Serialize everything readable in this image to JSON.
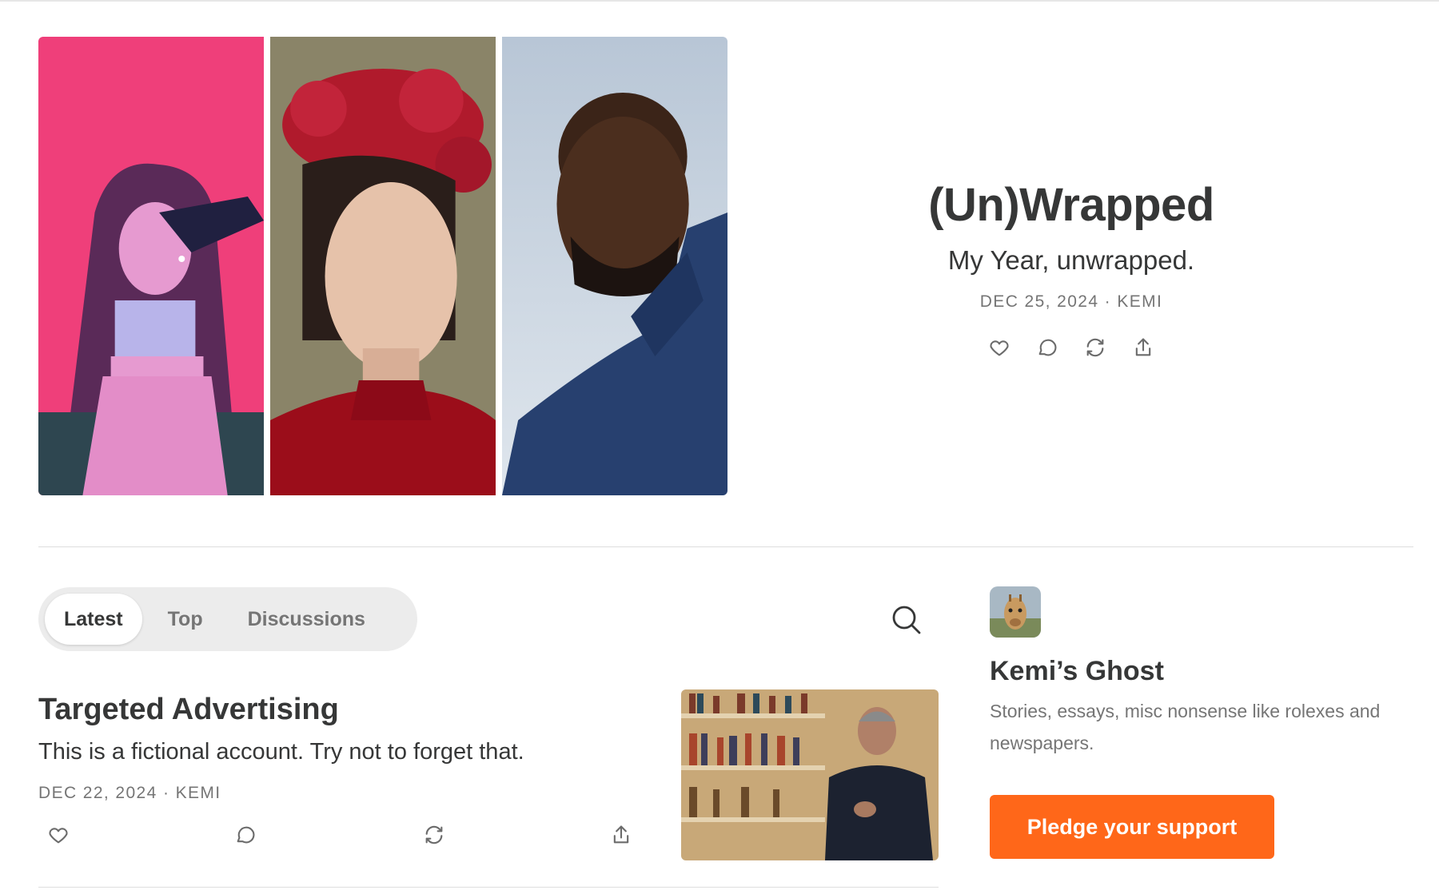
{
  "hero": {
    "title": "(Un)Wrapped",
    "subtitle": "My Year, unwrapped.",
    "meta": "DEC 25, 2024 · KEMI",
    "images": [
      "illustrated-woman-with-crow",
      "woman-with-red-flower-crown",
      "man-in-blue-shirt"
    ]
  },
  "tabs": [
    {
      "label": "Latest",
      "active": true
    },
    {
      "label": "Top",
      "active": false
    },
    {
      "label": "Discussions",
      "active": false
    }
  ],
  "post": {
    "title": "Targeted Advertising",
    "subtitle": "This is a fictional account. Try not to forget that.",
    "meta": "DEC 22, 2024 · KEMI",
    "thumbnail": "man-with-bookshelf"
  },
  "sidebar": {
    "publication_name": "Kemi’s Ghost",
    "description": "Stories, essays, misc nonsense like rolexes and newspapers.",
    "pledge_label": "Pledge your support",
    "avatar": "giraffe-avatar"
  },
  "icons": {
    "like": "heart-icon",
    "comment": "comment-icon",
    "restack": "restack-icon",
    "share": "share-icon",
    "search": "search-icon"
  },
  "colors": {
    "accent": "#ff6719",
    "text": "#363737",
    "muted": "#757575"
  }
}
